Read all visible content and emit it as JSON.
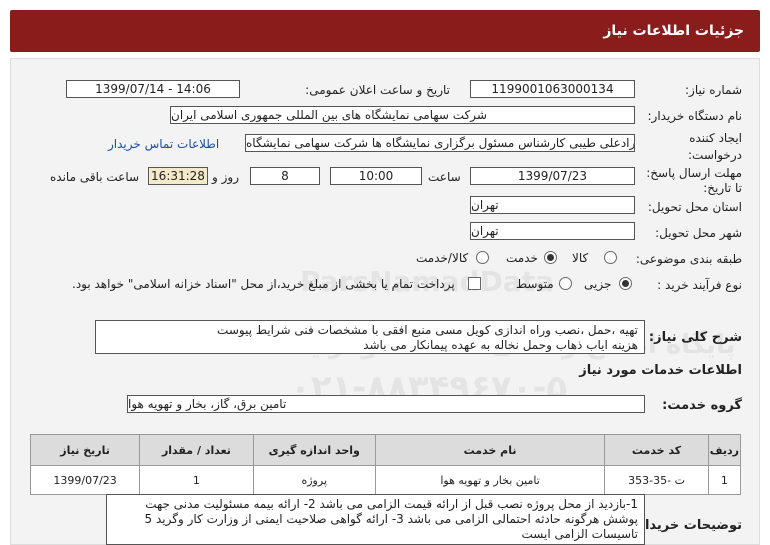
{
  "header": {
    "title": "جزئیات اطلاعات نیاز"
  },
  "form": {
    "need_number": {
      "label": "شماره نیاز:",
      "value": "1199001063000134"
    },
    "announce": {
      "label": "تاریخ و ساعت اعلان عمومی:",
      "value": "1399/07/14 - 14:06"
    },
    "buyer": {
      "label": "نام دستگاه خریدار:",
      "value": "شرکت سهامی نمایشگاه های بین المللی جمهوری اسلامی ایران"
    },
    "creator": {
      "label_line1": "ایجاد کننده",
      "label_line2": "درخواست:",
      "value": "مرادعلی طیبی کارشناس مسئول برگزاری نمایشگاه ها شرکت سهامی نمایشگاه",
      "contact_link": "اطلاعات تماس خریدار"
    },
    "deadline": {
      "label_line1": "مهلت ارسال پاسخ:",
      "label_line2": "تا تاریخ:",
      "date": "1399/07/23",
      "time_label": "ساعت",
      "time": "10:00",
      "days": "8",
      "days_label": "روز و",
      "remaining": "16:31:28",
      "remaining_label": "ساعت باقی مانده"
    },
    "province": {
      "label": "استان محل تحویل:",
      "value": "تهران"
    },
    "city": {
      "label": "شهر محل تحویل:",
      "value": "تهران"
    },
    "category": {
      "label": "طبقه بندی موضوعی:",
      "options": [
        "کالا",
        "خدمت",
        "کالا/خدمت"
      ],
      "selected": "خدمت"
    },
    "process": {
      "label": "نوع فرآیند خرید :",
      "options": [
        "جزیی",
        "متوسط"
      ],
      "selected": "جزیی",
      "payment_text": "پرداخت تمام یا بخشی از مبلغ خرید،از محل \"اسناد خزانه اسلامی\" خواهد بود."
    }
  },
  "description": {
    "label": "شرح کلی نیاز:",
    "line1": "تهیه ،حمل ،نصب وراه اندازی کویل  مسی منبع افقی با مشخصات فنی شرایط  پیوست",
    "line2": "هزینه ایاب ذهاب وحمل نخاله به عهده پیمانکار می باشد"
  },
  "services_section": {
    "title": "اطلاعات خدمات مورد نیاز"
  },
  "service_group": {
    "label": "گروه خدمت:",
    "value": "تامین برق، گاز، بخار و تهویه هوا"
  },
  "table": {
    "headers": [
      "ردیف",
      "کد خدمت",
      "نام خدمت",
      "واحد اندازه گیری",
      "تعداد / مقدار",
      "تاریخ نیاز"
    ],
    "rows": [
      [
        "1",
        "ت -35-353",
        "تامین بخار و تهویه هوا",
        "پروژه",
        "1",
        "1399/07/23"
      ]
    ]
  },
  "buyer_notes": {
    "label": "توضیحات خریدار:",
    "lines": [
      "1-بازدید از محل پروژه نصب قبل از ارائه قیمت الزامی می باشد 2- ارائه بیمه مسئولیت مدنی جهت",
      "پوشش هرگونه حادثه  احتمالی الزامی می باشد 3- ارائه گواهی صلاحیت ایمنی از وزارت کار وگرید 5",
      "تاسیسات الزامی ایست"
    ]
  },
  "watermark": {
    "line1": "ParsNamadData",
    "line2": "پایگاه اطلاع رسانی مناقصه ومزایده",
    "line3": "۰۲۱-۸۸۳۴۹۶۷۰-۵"
  },
  "colors": {
    "header_bg": "#8b1c1c",
    "link": "#1a4fa8",
    "remaining_bg": "#f4e9c8"
  }
}
